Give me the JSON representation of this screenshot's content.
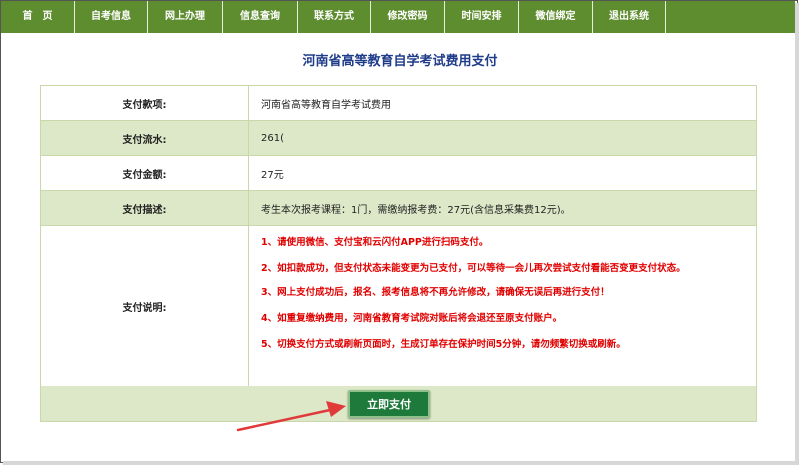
{
  "nav": {
    "items": [
      "首　页",
      "自考信息",
      "网上办理",
      "信息查询",
      "联系方式",
      "修改密码",
      "时间安排",
      "微信绑定",
      "退出系统"
    ]
  },
  "page": {
    "title": "河南省高等教育自学考试费用支付"
  },
  "payment": {
    "rows": [
      {
        "label": "支付款项:",
        "value": "河南省高等教育自学考试费用"
      },
      {
        "label": "支付流水:",
        "value": "261("
      },
      {
        "label": "支付金额:",
        "value": "27元"
      },
      {
        "label": "支付描述:",
        "value": "考生本次报考课程：1门，需缴纳报考费：27元(含信息采集费12元)。"
      }
    ],
    "notes_label": "支付说明:",
    "notes": [
      "1、请使用微信、支付宝和云闪付APP进行扫码支付。",
      "2、如扣款成功，但支付状态未能变更为已支付，可以等待一会儿再次尝试支付看能否变更支付状态。",
      "3、网上支付成功后，报名、报考信息将不再允许修改，请确保无误后再进行支付！",
      "4、如重复缴纳费用，河南省教育考试院对账后将会退还至原支付账户。",
      "5、切换支付方式或刷新页面时，生成订单存在保护时间5分钟，请勿频繁切换或刷新。"
    ],
    "pay_button": "立即支付"
  },
  "colors": {
    "nav_bg": "#5e8d2f",
    "title": "#1f3c8a",
    "note_text": "#e00000",
    "row_shade": "#dce8c7",
    "button_bg": "#1e7a3a",
    "annotation_arrow": "#e03a3a"
  }
}
